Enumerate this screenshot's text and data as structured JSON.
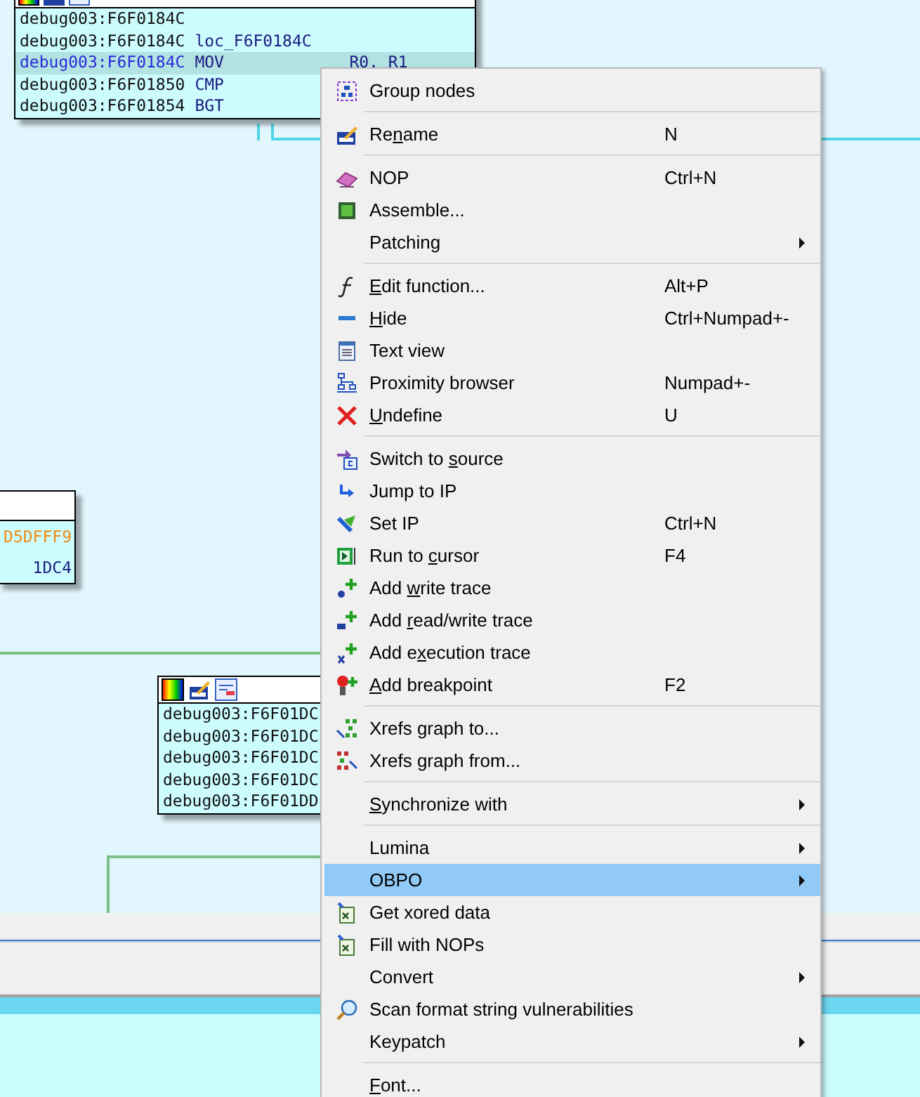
{
  "nodes": [
    {
      "lines": [
        {
          "address": "debug003:F6F0184C",
          "selected": false
        },
        {
          "address": "debug003:F6F0184C",
          "mnemonic": "loc_F6F0184C",
          "selected": false
        },
        {
          "address": "debug003:F6F0184C",
          "mnemonic": "MOV",
          "operands": "R0, R1",
          "selected": true
        },
        {
          "address": "debug003:F6F01850",
          "mnemonic": "CMP",
          "selected": false
        },
        {
          "address": "debug003:F6F01854",
          "mnemonic": "BGT",
          "selected": false
        }
      ]
    },
    {
      "lines": [
        {
          "address": "D5DFFF9",
          "kind": "immediate",
          "selected": false
        },
        {
          "address": "1DC4",
          "kind": "code",
          "selected": false
        }
      ]
    },
    {
      "lines": [
        {
          "address": "debug003:F6F01DC",
          "selected": false
        },
        {
          "address": "debug003:F6F01DC",
          "selected": false
        },
        {
          "address": "debug003:F6F01DC",
          "selected": false
        },
        {
          "address": "debug003:F6F01DC",
          "selected": false
        },
        {
          "address": "debug003:F6F01DD",
          "selected": false
        }
      ]
    }
  ],
  "menu": {
    "sections": [
      [
        {
          "label": "Group nodes",
          "selected": false
        }
      ],
      [
        {
          "label_parts": {
            "pre": "Re",
            "key": "n",
            "post": "ame"
          },
          "shortcut": "N",
          "selected": false
        }
      ],
      [
        {
          "label": "NOP",
          "shortcut": "Ctrl+N",
          "selected": false
        },
        {
          "label": "Assemble...",
          "selected": false
        },
        {
          "label": "Patching",
          "submenu": true,
          "selected": false
        }
      ],
      [
        {
          "label_parts": {
            "key": "E",
            "post": "dit function..."
          },
          "shortcut": "Alt+P",
          "selected": false
        },
        {
          "label_parts": {
            "key": "H",
            "post": "ide"
          },
          "shortcut": "Ctrl+Numpad+-",
          "selected": false
        },
        {
          "label": "Text view",
          "selected": false
        },
        {
          "label": "Proximity browser",
          "shortcut": "Numpad+-",
          "selected": false
        },
        {
          "label_parts": {
            "key": "U",
            "post": "ndefine"
          },
          "shortcut": "U",
          "selected": false
        }
      ],
      [
        {
          "label_parts": {
            "pre": "Switch to ",
            "key": "s",
            "post": "ource"
          },
          "selected": false
        },
        {
          "label": "Jump to IP",
          "selected": false
        },
        {
          "label": "Set IP",
          "shortcut": "Ctrl+N",
          "selected": false
        },
        {
          "label_parts": {
            "pre": "Run to ",
            "key": "c",
            "post": "ursor"
          },
          "shortcut": "F4",
          "selected": false
        },
        {
          "label_parts": {
            "pre": "Add ",
            "key": "w",
            "post": "rite trace"
          },
          "selected": false
        },
        {
          "label_parts": {
            "pre": "Add ",
            "key": "r",
            "post": "ead/write trace"
          },
          "selected": false
        },
        {
          "label_parts": {
            "pre": "Add e",
            "key": "x",
            "post": "ecution trace"
          },
          "selected": false
        },
        {
          "label_parts": {
            "key": "A",
            "post": "dd breakpoint"
          },
          "shortcut": "F2",
          "selected": false
        }
      ],
      [
        {
          "label": "Xrefs graph to...",
          "selected": false
        },
        {
          "label": "Xrefs graph from...",
          "selected": false
        }
      ],
      [
        {
          "label_parts": {
            "key": "S",
            "post": "ynchronize with"
          },
          "submenu": true,
          "selected": false
        }
      ],
      [
        {
          "label": "Lumina",
          "submenu": true,
          "selected": false
        },
        {
          "label": "OBPO",
          "submenu": true,
          "selected": true
        },
        {
          "label": "Get xored data",
          "selected": false
        },
        {
          "label": "Fill with NOPs",
          "selected": false
        },
        {
          "label": "Convert",
          "submenu": true,
          "selected": false
        },
        {
          "label": "Scan format string vulnerabilities",
          "selected": false
        },
        {
          "label": "Keypatch",
          "submenu": true,
          "selected": false
        }
      ],
      [
        {
          "label_parts": {
            "key": "F",
            "post": "ont..."
          },
          "selected": false
        }
      ]
    ]
  }
}
